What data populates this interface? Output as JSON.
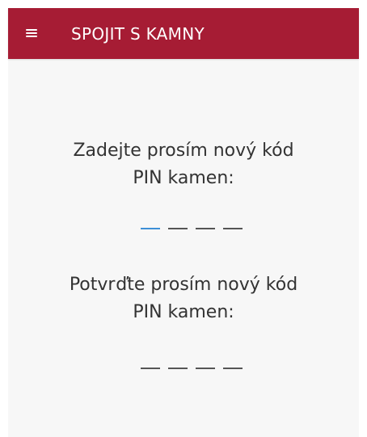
{
  "app_bar": {
    "title": "SPOJIT S KAMNY",
    "menu_icon": "hamburger-menu-icon",
    "background_color": "#a61c34"
  },
  "new_pin": {
    "prompt_line1": "Zadejte prosím nový kód",
    "prompt_line2": "PIN kamen:",
    "digits_entered": 0,
    "active_slot": 1,
    "slot_count": 4
  },
  "confirm_pin": {
    "prompt_line1": "Potvrďte prosím nový kód",
    "prompt_line2": "PIN kamen:",
    "digits_entered": 0,
    "slot_count": 4
  },
  "colors": {
    "accent_active": "#3d8fd6",
    "slot_inactive": "#555555"
  }
}
